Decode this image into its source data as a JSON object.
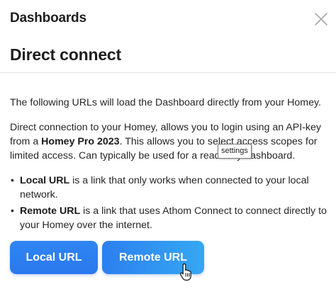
{
  "header": {
    "title": "Dashboards"
  },
  "section": {
    "title": "Direct connect"
  },
  "intro": "The following URLs will load the Dashboard directly from your Homey.",
  "description": {
    "part1": "Direct connection to your Homey, allows you to login using an API-key from a ",
    "bold": "Homey Pro 2023",
    "part2": ". This allows you to select access scopes for limited access. Can typically be used for a read-only dashboard."
  },
  "bullets": [
    {
      "bold": "Local URL",
      "text": " is a link that only works when connected to your local network."
    },
    {
      "bold": "Remote URL",
      "text": " is a link that uses Athom Connect to connect directly to your Homey over the internet."
    }
  ],
  "buttons": {
    "local": "Local URL",
    "remote": "Remote URL"
  },
  "tooltip": "settings",
  "icons": {
    "close": "close-icon",
    "cursor": "hand-pointer-cursor"
  },
  "colors": {
    "accent": "#2f86f2",
    "accent_light": "#35a8f2"
  }
}
